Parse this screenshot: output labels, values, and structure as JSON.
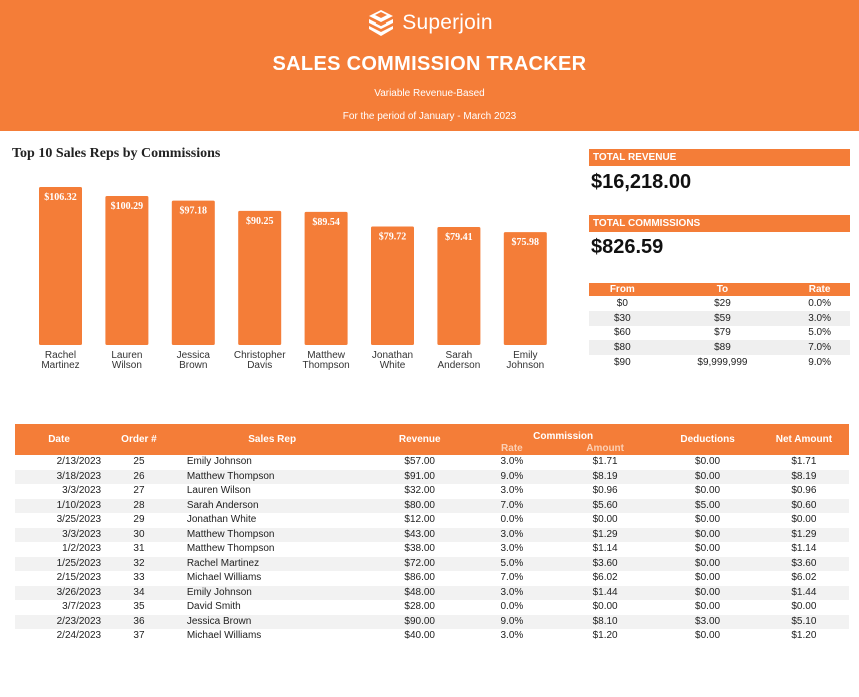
{
  "banner": {
    "brand_name": "Superjoin",
    "brand_icon": "superjoin-logo-icon",
    "title": "SALES COMMISSION TRACKER",
    "subtitle": "Variable Revenue-Based",
    "period": "For the period of January - March 2023",
    "color": "#f47d38"
  },
  "chart_data": {
    "type": "bar",
    "title": "Top 10 Sales Reps by Commissions",
    "categories": [
      "Rachel Martinez",
      "Lauren Wilson",
      "Jessica Brown",
      "Christopher Davis",
      "Matthew Thompson",
      "Jonathan White",
      "Sarah Anderson",
      "Emily Johnson"
    ],
    "category_lines": [
      [
        "Rachel",
        "Martinez"
      ],
      [
        "Lauren",
        "Wilson"
      ],
      [
        "Jessica",
        "Brown"
      ],
      [
        "Christopher",
        "Davis"
      ],
      [
        "Matthew",
        "Thompson"
      ],
      [
        "Jonathan",
        "White"
      ],
      [
        "Sarah",
        "Anderson"
      ],
      [
        "Emily",
        "Johnson"
      ]
    ],
    "values": [
      106.32,
      100.29,
      97.18,
      90.25,
      89.54,
      79.72,
      79.41,
      75.98
    ],
    "data_labels": [
      "$106.32",
      "$100.29",
      "$97.18",
      "$90.25",
      "$89.54",
      "$79.72",
      "$79.41",
      "$75.98"
    ],
    "xlabel": "",
    "ylabel": "",
    "ylim": [
      0,
      115
    ],
    "grid": false,
    "legend": "none",
    "bar_color": "#f47d38"
  },
  "kpis": {
    "total_revenue_label": "TOTAL REVENUE",
    "total_revenue_value": "$16,218.00",
    "total_commissions_label": "TOTAL COMMISSIONS",
    "total_commissions_value": "$826.59"
  },
  "rate_table": {
    "headers": [
      "From",
      "To",
      "Rate"
    ],
    "rows": [
      [
        "$0",
        "$29",
        "0.0%"
      ],
      [
        "$30",
        "$59",
        "3.0%"
      ],
      [
        "$60",
        "$79",
        "5.0%"
      ],
      [
        "$80",
        "$89",
        "7.0%"
      ],
      [
        "$90",
        "$9,999,999",
        "9.0%"
      ]
    ]
  },
  "orders": {
    "headers": {
      "date": "Date",
      "order": "Order #",
      "rep": "Sales Rep",
      "revenue": "Revenue",
      "commission": "Commission",
      "rate": "Rate",
      "amount": "Amount",
      "deductions": "Deductions",
      "net": "Net Amount"
    },
    "rows": [
      [
        "2/13/2023",
        "25",
        "Emily Johnson",
        "$57.00",
        "3.0%",
        "$1.71",
        "$0.00",
        "$1.71"
      ],
      [
        "3/18/2023",
        "26",
        "Matthew Thompson",
        "$91.00",
        "9.0%",
        "$8.19",
        "$0.00",
        "$8.19"
      ],
      [
        "3/3/2023",
        "27",
        "Lauren Wilson",
        "$32.00",
        "3.0%",
        "$0.96",
        "$0.00",
        "$0.96"
      ],
      [
        "1/10/2023",
        "28",
        "Sarah Anderson",
        "$80.00",
        "7.0%",
        "$5.60",
        "$5.00",
        "$0.60"
      ],
      [
        "3/25/2023",
        "29",
        "Jonathan White",
        "$12.00",
        "0.0%",
        "$0.00",
        "$0.00",
        "$0.00"
      ],
      [
        "3/3/2023",
        "30",
        "Matthew Thompson",
        "$43.00",
        "3.0%",
        "$1.29",
        "$0.00",
        "$1.29"
      ],
      [
        "1/2/2023",
        "31",
        "Matthew Thompson",
        "$38.00",
        "3.0%",
        "$1.14",
        "$0.00",
        "$1.14"
      ],
      [
        "1/25/2023",
        "32",
        "Rachel Martinez",
        "$72.00",
        "5.0%",
        "$3.60",
        "$0.00",
        "$3.60"
      ],
      [
        "2/15/2023",
        "33",
        "Michael Williams",
        "$86.00",
        "7.0%",
        "$6.02",
        "$0.00",
        "$6.02"
      ],
      [
        "3/26/2023",
        "34",
        "Emily Johnson",
        "$48.00",
        "3.0%",
        "$1.44",
        "$0.00",
        "$1.44"
      ],
      [
        "3/7/2023",
        "35",
        "David Smith",
        "$28.00",
        "0.0%",
        "$0.00",
        "$0.00",
        "$0.00"
      ],
      [
        "2/23/2023",
        "36",
        "Jessica Brown",
        "$90.00",
        "9.0%",
        "$8.10",
        "$3.00",
        "$5.10"
      ],
      [
        "2/24/2023",
        "37",
        "Michael Williams",
        "$40.00",
        "3.0%",
        "$1.20",
        "$0.00",
        "$1.20"
      ]
    ]
  }
}
